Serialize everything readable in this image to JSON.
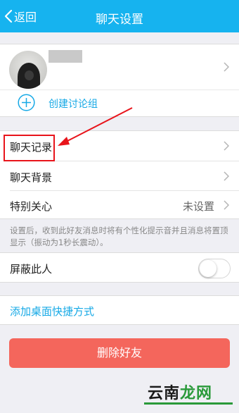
{
  "navbar": {
    "back_label": "返回",
    "title": "聊天设置",
    "background_color": "#16b3ef"
  },
  "profile": {
    "create_group_label": "创建讨论组"
  },
  "settings": {
    "chat_history_label": "聊天记录",
    "chat_background_label": "聊天背景",
    "special_care_label": "特别关心",
    "special_care_value": "未设置"
  },
  "hint_text": "设置后，收到此好友消息时将有个性化提示音并且消息将置顶显示（振动为1秒长震动）。",
  "block": {
    "label": "屏蔽此人",
    "enabled": false
  },
  "shortcut_label": "添加桌面快捷方式",
  "delete_button_label": "删除好友",
  "watermark": {
    "part1": "云南",
    "part2": "龙网"
  },
  "annotation_color": "#e8141b",
  "accent_color": "#16a9e6",
  "danger_color": "#f4665c"
}
